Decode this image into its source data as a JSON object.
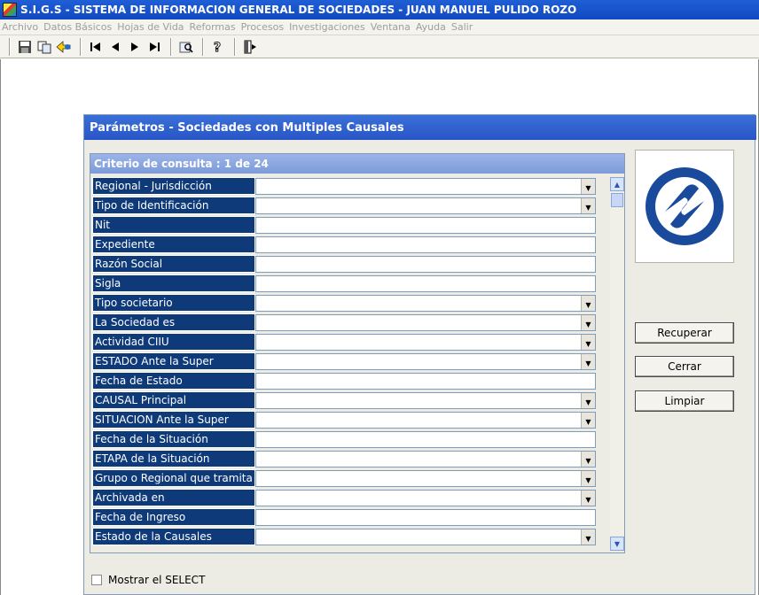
{
  "window": {
    "app_name": "S.I.G.S",
    "title": " - SISTEMA DE INFORMACION GENERAL DE SOCIEDADES - JUAN MANUEL PULIDO ROZO"
  },
  "menu": [
    "Archivo",
    "Datos Básicos",
    "Hojas de Vida",
    "Reformas",
    "Procesos",
    "Investigaciones",
    "Ventana",
    "Ayuda",
    "Salir"
  ],
  "toolbar": {
    "icons": [
      "save-icon",
      "copy-icon",
      "back-icon",
      "first-record-icon",
      "previous-record-icon",
      "next-record-icon",
      "last-record-icon",
      "query-icon",
      "help-icon",
      "exit-icon"
    ]
  },
  "panel": {
    "title": "Parámetros -  Sociedades con Multiples Causales",
    "criteria_header": "Criterio de consulta : 1  de  24"
  },
  "fields": [
    {
      "label": "Regional - Jurisdicción",
      "dropdown": true,
      "value": ""
    },
    {
      "label": "Tipo de Identificación",
      "dropdown": true,
      "value": ""
    },
    {
      "label": "Nit",
      "dropdown": false,
      "value": ""
    },
    {
      "label": "Expediente",
      "dropdown": false,
      "value": ""
    },
    {
      "label": "Razón Social",
      "dropdown": false,
      "value": ""
    },
    {
      "label": "Sigla",
      "dropdown": false,
      "value": ""
    },
    {
      "label": "Tipo societario",
      "dropdown": true,
      "value": ""
    },
    {
      "label": "La Sociedad es",
      "dropdown": true,
      "value": ""
    },
    {
      "label": "Actividad CIIU",
      "dropdown": true,
      "value": ""
    },
    {
      "label": "ESTADO Ante la Super",
      "dropdown": true,
      "value": ""
    },
    {
      "label": "Fecha de Estado",
      "dropdown": false,
      "value": ""
    },
    {
      "label": "CAUSAL Principal",
      "dropdown": true,
      "value": ""
    },
    {
      "label": "SITUACION Ante la Super",
      "dropdown": true,
      "value": ""
    },
    {
      "label": "Fecha de la Situación",
      "dropdown": false,
      "value": ""
    },
    {
      "label": "ETAPA de la Situación",
      "dropdown": true,
      "value": ""
    },
    {
      "label": "Grupo o Regional que tramita",
      "dropdown": true,
      "value": ""
    },
    {
      "label": "Archivada en",
      "dropdown": true,
      "value": ""
    },
    {
      "label": "Fecha de Ingreso",
      "dropdown": false,
      "value": ""
    },
    {
      "label": "Estado de la Causales",
      "dropdown": true,
      "value": ""
    }
  ],
  "buttons": {
    "recuperar": "Recuperar",
    "cerrar": "Cerrar",
    "limpiar": "Limpiar"
  },
  "show_select": {
    "label": "Mostrar el SELECT",
    "checked": false
  },
  "colors": {
    "title_blue": "#1f5fd6",
    "label_navy": "#0e3a7a",
    "panel_bg": "#ecebe4",
    "logo_blue": "#1a4a9c"
  }
}
